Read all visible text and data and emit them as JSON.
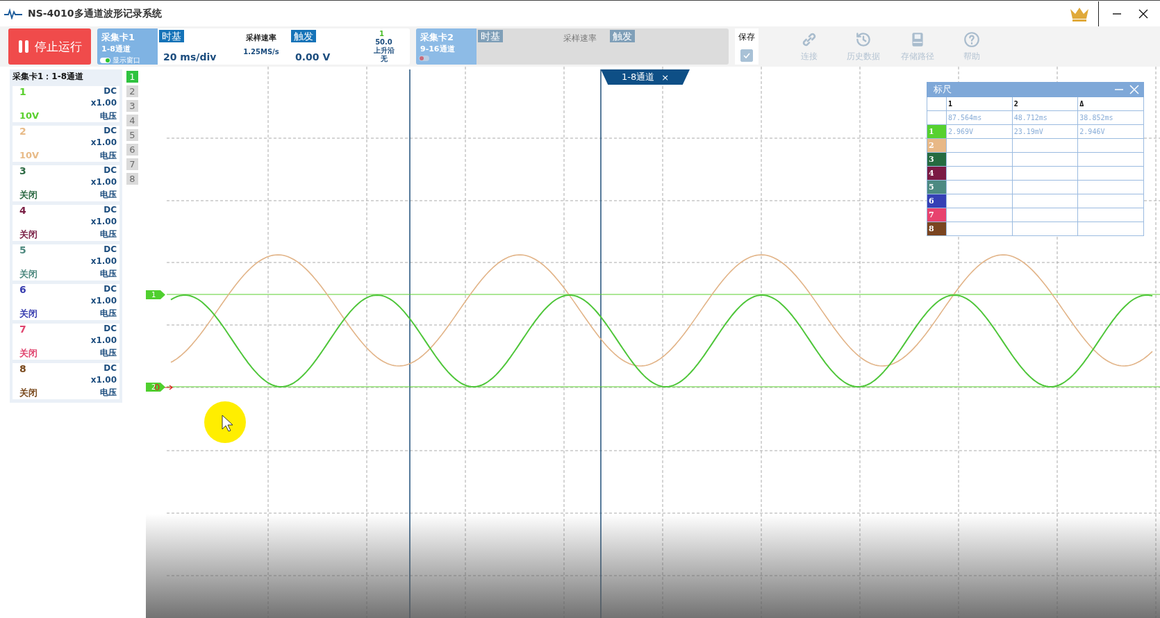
{
  "window": {
    "title": "NS-4010多通道波形记录系统"
  },
  "toolbar": {
    "stop_button": "停止运行",
    "cards": [
      {
        "name": "采集卡1",
        "channels": "1-8通道",
        "toggle_label": "显示窗口",
        "toggle_on": true,
        "disabled": false,
        "timebase_label": "时基",
        "timebase": "20 ms/div",
        "sample_rate_label": "采样速率",
        "sample_rate": "1.25MS/s",
        "trigger_label": "触发",
        "trigger_value": "0.00 V",
        "trigger_channel": "1",
        "trigger_level": "50.0",
        "trigger_edge": "上升沿",
        "trigger_mode": "无"
      },
      {
        "name": "采集卡2",
        "channels": "9-16通道",
        "toggle_on": false,
        "disabled": true,
        "timebase_label": "时基",
        "sample_rate_label": "采样速率",
        "trigger_label": "触发"
      }
    ],
    "save": {
      "label": "保存",
      "checked": true
    },
    "tools": [
      {
        "kind": "link",
        "label": "连接",
        "disabled": true
      },
      {
        "kind": "history",
        "label": "历史数据",
        "disabled": true
      },
      {
        "kind": "storage",
        "label": "存储路径",
        "disabled": true
      },
      {
        "kind": "help",
        "label": "帮助",
        "disabled": true
      }
    ]
  },
  "channel_panel": {
    "title": "采集卡1：1-8通道",
    "channels": [
      {
        "number": "1",
        "color": "#5ad02e",
        "coupling": "DC",
        "gain": "x1.00",
        "range": "10V",
        "unit": "电压"
      },
      {
        "number": "2",
        "color": "#e8bb88",
        "coupling": "DC",
        "gain": "x1.00",
        "range": "10V",
        "unit": "电压"
      },
      {
        "number": "3",
        "color": "#2e6b45",
        "coupling": "DC",
        "gain": "x1.00",
        "range": "关闭",
        "unit": "电压"
      },
      {
        "number": "4",
        "color": "#7a1f45",
        "coupling": "DC",
        "gain": "x1.00",
        "range": "关闭",
        "unit": "电压"
      },
      {
        "number": "5",
        "color": "#4f8a80",
        "coupling": "DC",
        "gain": "x1.00",
        "range": "关闭",
        "unit": "电压"
      },
      {
        "number": "6",
        "color": "#3a3fb0",
        "coupling": "DC",
        "gain": "x1.00",
        "range": "关闭",
        "unit": "电压"
      },
      {
        "number": "7",
        "color": "#e0456f",
        "coupling": "DC",
        "gain": "x1.00",
        "range": "关闭",
        "unit": "电压"
      },
      {
        "number": "8",
        "color": "#7a4a1e",
        "coupling": "DC",
        "gain": "x1.00",
        "range": "关闭",
        "unit": "电压"
      }
    ]
  },
  "channel_selector": [
    {
      "label": "1",
      "selected": true
    },
    {
      "label": "2",
      "selected": false
    },
    {
      "label": "3",
      "selected": false
    },
    {
      "label": "4",
      "selected": false
    },
    {
      "label": "5",
      "selected": false
    },
    {
      "label": "6",
      "selected": false
    },
    {
      "label": "7",
      "selected": false
    },
    {
      "label": "8",
      "selected": false
    }
  ],
  "plot": {
    "tab": {
      "label": "1-8通道",
      "close": "×"
    },
    "markers": [
      {
        "label": "1"
      },
      {
        "label": "2"
      }
    ],
    "trigger_marker": "0",
    "ruler": {
      "title": "标尺",
      "columns": [
        "1",
        "2",
        "Δ"
      ],
      "times": [
        "87.564ms",
        "48.712ms",
        "38.852ms"
      ],
      "rows": [
        {
          "label": "1",
          "color": "#56d12f",
          "values": [
            "2.969V",
            "23.19mV",
            "2.946V"
          ]
        },
        {
          "label": "2",
          "color": "#e8b886"
        },
        {
          "label": "3",
          "color": "#256b40"
        },
        {
          "label": "4",
          "color": "#7b1a44"
        },
        {
          "label": "5",
          "color": "#4c8a82"
        },
        {
          "label": "6",
          "color": "#3540b5"
        },
        {
          "label": "7",
          "color": "#e8426e"
        },
        {
          "label": "8",
          "color": "#7a4520"
        }
      ]
    }
  }
}
